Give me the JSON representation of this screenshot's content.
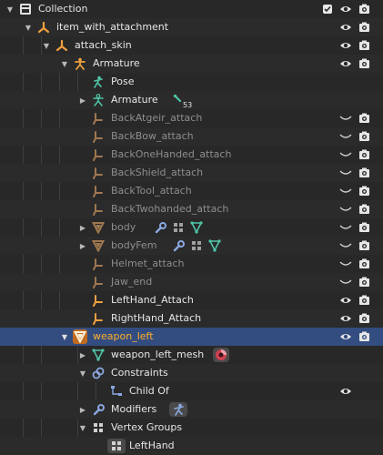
{
  "outliner": {
    "rows": [
      {
        "label": "Collection",
        "icon": "collection-icon",
        "expand": "down",
        "checkbox": true,
        "eye": true,
        "camera": true
      },
      {
        "label": "item_with_attachment",
        "icon": "empty-icon",
        "expand": "down",
        "eye": true,
        "camera": true
      },
      {
        "label": "attach_skin",
        "icon": "empty-icon",
        "expand": "down",
        "eye": true,
        "camera": true
      },
      {
        "label": "Armature",
        "icon": "armature-icon",
        "expand": "down",
        "eye": true,
        "camera": true
      },
      {
        "label": "Pose",
        "icon": "pose-icon"
      },
      {
        "label": "Armature",
        "icon": "armature-data-icon",
        "expand": "right",
        "badge": "53"
      },
      {
        "label": "BackAtgeir_attach",
        "icon": "bone-icon",
        "eye_closed": true,
        "camera": true
      },
      {
        "label": "BackBow_attach",
        "icon": "bone-icon",
        "eye_closed": true,
        "camera": true
      },
      {
        "label": "BackOneHanded_attach",
        "icon": "bone-icon",
        "eye_closed": true,
        "camera": true
      },
      {
        "label": "BackShield_attach",
        "icon": "bone-icon",
        "eye_closed": true,
        "camera": true
      },
      {
        "label": "BackTool_attach",
        "icon": "bone-icon",
        "eye_closed": true,
        "camera": true
      },
      {
        "label": "BackTwohanded_attach",
        "icon": "bone-icon",
        "eye_closed": true,
        "camera": true
      },
      {
        "label": "body",
        "icon": "mesh-icon",
        "expand": "right",
        "extras": [
          "wrench-icon",
          "vertex-groups-icon",
          "mesh-data-icon"
        ],
        "eye_closed": true,
        "camera": true
      },
      {
        "label": "bodyFem",
        "icon": "mesh-icon",
        "expand": "right",
        "extras": [
          "wrench-icon",
          "vertex-groups-icon",
          "mesh-data-icon"
        ],
        "eye_closed": true,
        "camera": true
      },
      {
        "label": "Helmet_attach",
        "icon": "bone-icon",
        "eye_closed": true,
        "camera": true
      },
      {
        "label": "Jaw_end",
        "icon": "bone-icon",
        "eye_closed": true,
        "camera": true
      },
      {
        "label": "LeftHand_Attach",
        "icon": "bone-icon",
        "eye": true,
        "camera": true
      },
      {
        "label": "RightHand_Attach",
        "icon": "bone-icon",
        "eye": true,
        "camera": true
      },
      {
        "label": "weapon_left",
        "icon": "mesh-icon",
        "expand": "down",
        "eye": true,
        "camera": true
      },
      {
        "label": "weapon_left_mesh",
        "icon": "mesh-data-icon",
        "expand": "right",
        "extras": [
          "material-icon"
        ]
      },
      {
        "label": "Constraints",
        "icon": "constraint-icon",
        "expand": "down"
      },
      {
        "label": "Child Of",
        "icon": "child-of-icon",
        "eye": true
      },
      {
        "label": "Modifiers",
        "icon": "wrench-icon",
        "expand": "right",
        "extras": [
          "armature-modifier-icon"
        ]
      },
      {
        "label": "Vertex Groups",
        "icon": "vertex-groups-icon",
        "expand": "down"
      },
      {
        "label": "LeftHand",
        "icon": "vertex-group-icon"
      }
    ]
  }
}
